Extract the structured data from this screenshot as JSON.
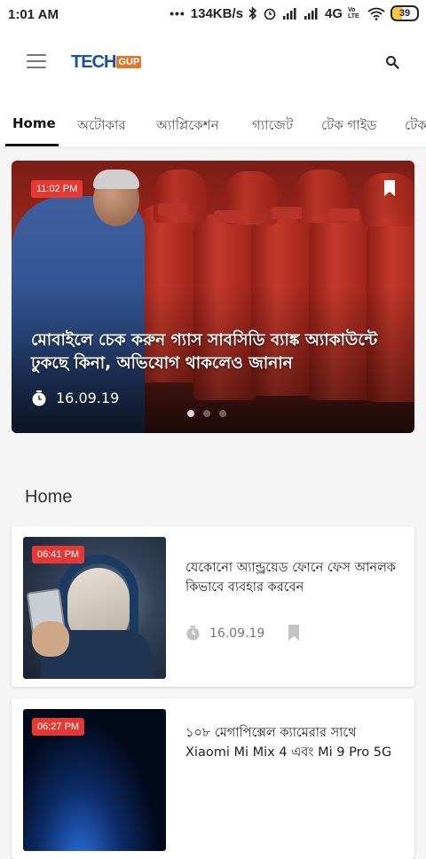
{
  "status_bar": {
    "time": "1:01 AM",
    "dots": "•••",
    "net_speed": "134KB/s",
    "network_type": "4G",
    "volte": "Vo LTE",
    "battery": "39"
  },
  "app_bar": {
    "logo_main": "TECH",
    "logo_tag": "GUP"
  },
  "tabs": [
    "Home",
    "অটোকার",
    "অ্যাপ্লিকেশন",
    "গ্যাজেট",
    "টেক গাইড",
    "টেক"
  ],
  "hero": {
    "time_badge": "11:02 PM",
    "title": "মোবাইলে চেক করুন গ্যাস সাবসিডি ব্যাঙ্ক অ্যাকাউন্টে ঢুকছে কিনা, অভিযোগ থাকলেও জানান",
    "date": "16.09.19",
    "slide_count": 3,
    "active_slide": 1
  },
  "section": {
    "title": "Home"
  },
  "posts": [
    {
      "time_badge": "06:41 PM",
      "title": "যেকোনো অ্যান্ড্রয়েড ফোনে ফেস আনলক কিভাবে ব্যবহার করবেন",
      "date": "16.09.19"
    },
    {
      "time_badge": "06:27 PM",
      "title": "১০৮ মেগাপিক্সেল ক্যামেরার সাথে Xiaomi Mi Mix 4 এবং Mi 9 Pro 5G",
      "date": ""
    }
  ],
  "colors": {
    "badge": "#e53935",
    "logo_blue": "#1a4fa0",
    "logo_orange": "#e2772b"
  },
  "icons": [
    "hamburger-menu-icon",
    "search-icon",
    "bookmark-icon",
    "clock-icon"
  ]
}
